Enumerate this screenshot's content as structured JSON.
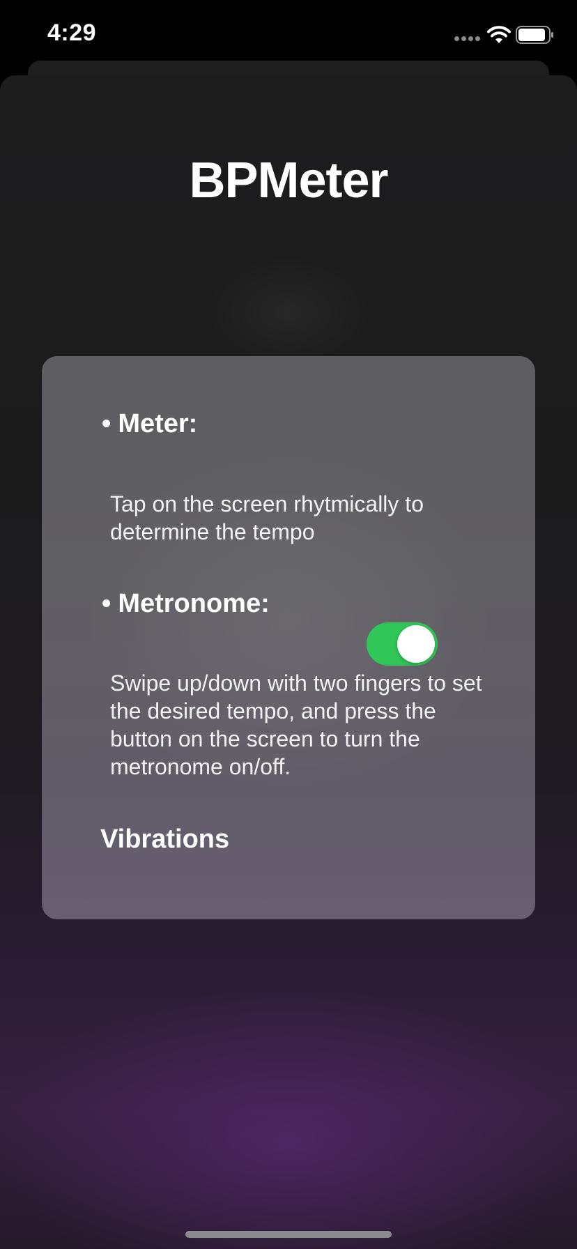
{
  "status_bar": {
    "time": "4:29",
    "icons": [
      "signal-icon",
      "wifi-icon",
      "battery-icon"
    ]
  },
  "app": {
    "title": "BPMeter"
  },
  "info_card": {
    "sections": [
      {
        "bullet": "•",
        "heading": "Meter:",
        "body": "Tap on the screen rhytmically to determine the tempo"
      },
      {
        "bullet": "•",
        "heading": "Metronome:",
        "body": "Swipe up/down with two fingers to set the desired tempo, and press the button on the screen to turn the metronome on/off."
      }
    ],
    "vibrations": {
      "label": "Vibrations",
      "enabled": true
    }
  },
  "colors": {
    "toggle_on": "#30c758",
    "card_background": "#605f63",
    "accent_glow": "#36203f"
  }
}
